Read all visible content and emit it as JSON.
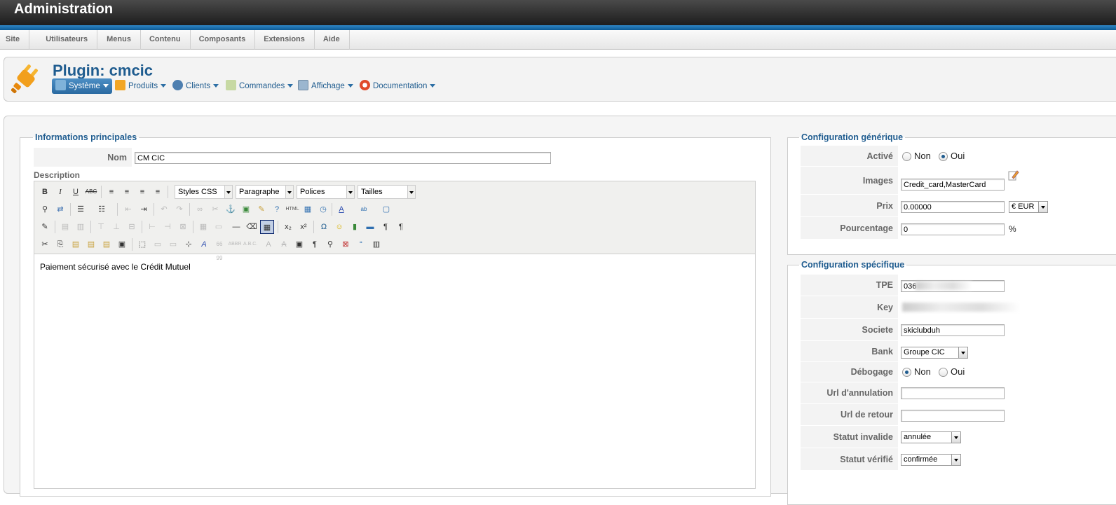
{
  "app": {
    "title": "Administration"
  },
  "menu": [
    "Site",
    "Utilisateurs",
    "Menus",
    "Contenu",
    "Composants",
    "Extensions",
    "Aide"
  ],
  "page": {
    "title": "Plugin: cmcic",
    "toolbar": [
      "Système",
      "Produits",
      "Clients",
      "Commandes",
      "Affichage",
      "Documentation"
    ]
  },
  "main_info": {
    "legend": "Informations principales",
    "name_label": "Nom",
    "name_value": "CM CIC",
    "description_label": "Description",
    "editor": {
      "styles_select": "Styles CSS",
      "format_select": "Paragraphe",
      "fonts_select": "Polices",
      "sizes_select": "Tailles",
      "content": "Paiement sécurisé avec le Crédit Mutuel"
    }
  },
  "generic": {
    "legend": "Configuration générique",
    "active_label": "Activé",
    "active_options": [
      "Non",
      "Oui"
    ],
    "active_selected": "Oui",
    "images_label": "Images",
    "images_value": "Credit_card,MasterCard",
    "price_label": "Prix",
    "price_value": "0.00000",
    "currency": "€ EUR",
    "percent_label": "Pourcentage",
    "percent_value": "0",
    "percent_unit": "%"
  },
  "specific": {
    "legend": "Configuration spécifique",
    "tpe_label": "TPE",
    "tpe_value": "036",
    "key_label": "Key",
    "societe_label": "Societe",
    "societe_value": "skiclubduh",
    "bank_label": "Bank",
    "bank_value": "Groupe CIC",
    "debug_label": "Débogage",
    "debug_options": [
      "Non",
      "Oui"
    ],
    "debug_selected": "Non",
    "cancel_url_label": "Url d'annulation",
    "return_url_label": "Url de retour",
    "invalid_status_label": "Statut invalide",
    "invalid_status_value": "annulée",
    "verified_status_label": "Statut vérifié",
    "verified_status_value": "confirmée"
  }
}
